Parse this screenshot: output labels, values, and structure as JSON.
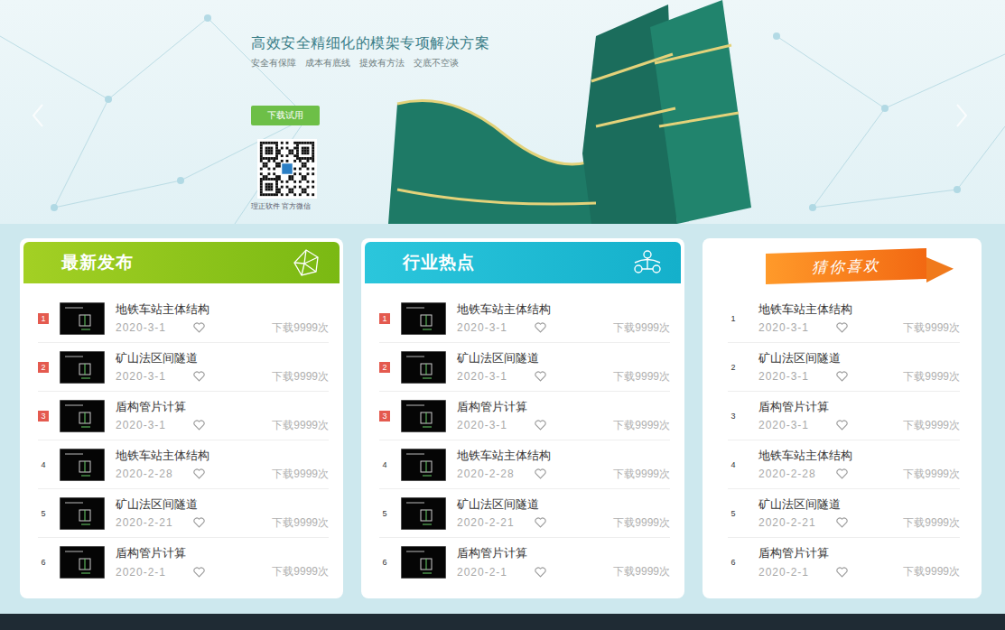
{
  "banner": {
    "title": "高效安全精细化的模架专项解决方案",
    "subtitle": [
      "安全有保障",
      "成本有底线",
      "提效有方法",
      "交底不空谈"
    ],
    "button": "下载试用",
    "qr_caption": "理正软件 官方微信"
  },
  "cards": [
    {
      "title": "最新发布",
      "kind": "green",
      "items": [
        {
          "rank": "1",
          "title": "地铁车站主体结构",
          "date": "2020-3-1",
          "downloads": "下载9999次",
          "highlighted": true,
          "liked": false
        },
        {
          "rank": "2",
          "title": "矿山法区间隧道",
          "date": "2020-3-1",
          "downloads": "下载9999次",
          "highlighted": true,
          "liked": false
        },
        {
          "rank": "3",
          "title": "盾构管片计算",
          "date": "2020-3-1",
          "downloads": "下载9999次",
          "highlighted": true,
          "liked": false
        },
        {
          "rank": "4",
          "title": "地铁车站主体结构",
          "date": "2020-2-28",
          "downloads": "下载9999次",
          "highlighted": false,
          "liked": false
        },
        {
          "rank": "5",
          "title": "矿山法区间隧道",
          "date": "2020-2-21",
          "downloads": "下载9999次",
          "highlighted": false,
          "liked": false
        },
        {
          "rank": "6",
          "title": "盾构管片计算",
          "date": "2020-2-1",
          "downloads": "下载9999次",
          "highlighted": false,
          "liked": false
        }
      ]
    },
    {
      "title": "行业热点",
      "kind": "cyan",
      "items": [
        {
          "rank": "1",
          "title": "地铁车站主体结构",
          "date": "2020-3-1",
          "downloads": "下载9999次",
          "highlighted": true,
          "liked": false
        },
        {
          "rank": "2",
          "title": "矿山法区间隧道",
          "date": "2020-3-1",
          "downloads": "下载9999次",
          "highlighted": true,
          "liked": false
        },
        {
          "rank": "3",
          "title": "盾构管片计算",
          "date": "2020-3-1",
          "downloads": "下载9999次",
          "highlighted": true,
          "liked": false
        },
        {
          "rank": "4",
          "title": "地铁车站主体结构",
          "date": "2020-2-28",
          "downloads": "下载9999次",
          "highlighted": false,
          "liked": false
        },
        {
          "rank": "5",
          "title": "矿山法区间隧道",
          "date": "2020-2-21",
          "downloads": "下载9999次",
          "highlighted": false,
          "liked": false
        },
        {
          "rank": "6",
          "title": "盾构管片计算",
          "date": "2020-2-1",
          "downloads": "下载9999次",
          "highlighted": false,
          "liked": false
        }
      ]
    },
    {
      "title": "猜你喜欢",
      "kind": "ribbon",
      "items": [
        {
          "rank": "1",
          "title": "地铁车站主体结构",
          "date": "2020-3-1",
          "downloads": "下载9999次",
          "highlighted": false,
          "liked": false
        },
        {
          "rank": "2",
          "title": "矿山法区间隧道",
          "date": "2020-3-1",
          "downloads": "下载9999次",
          "highlighted": false,
          "liked": false
        },
        {
          "rank": "3",
          "title": "盾构管片计算",
          "date": "2020-3-1",
          "downloads": "下载9999次",
          "highlighted": false,
          "liked": false
        },
        {
          "rank": "4",
          "title": "地铁车站主体结构",
          "date": "2020-2-28",
          "downloads": "下载9999次",
          "highlighted": false,
          "liked": false
        },
        {
          "rank": "5",
          "title": "矿山法区间隧道",
          "date": "2020-2-21",
          "downloads": "下载9999次",
          "highlighted": false,
          "liked": false
        },
        {
          "rank": "6",
          "title": "盾构管片计算",
          "date": "2020-2-1",
          "downloads": "下载9999次",
          "highlighted": false,
          "liked": false
        }
      ]
    }
  ]
}
